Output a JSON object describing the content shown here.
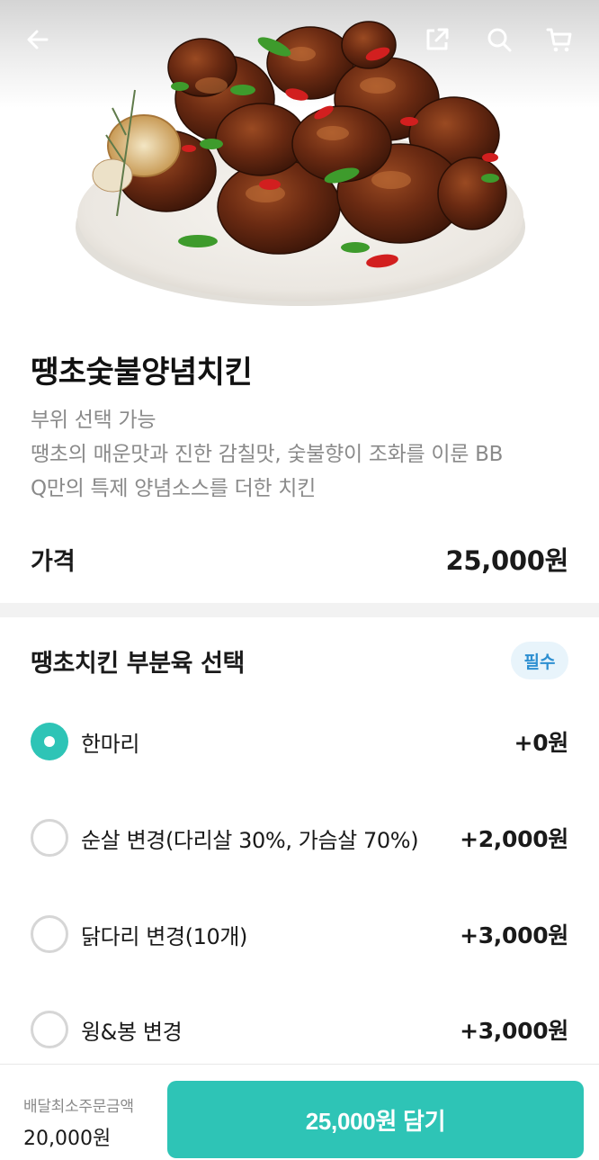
{
  "header": {
    "back_icon": "arrow-left-icon",
    "share_icon": "share-icon",
    "search_icon": "search-icon",
    "cart_icon": "cart-icon"
  },
  "product": {
    "name": "땡초숯불양념치킨",
    "description_lines": [
      "부위 선택 가능",
      "땡초의 매운맛과 진한 감칠맛, 숯불향이 조화를 이룬 BB",
      "Q만의 특제 양념소스를 더한 치킨"
    ],
    "price_label": "가격",
    "price_value": "25,000원"
  },
  "option_group": {
    "title": "땡초치킨 부분육 선택",
    "badge": "필수",
    "options": [
      {
        "label": "한마리",
        "price": "+0원",
        "selected": true
      },
      {
        "label": "순살 변경(다리살 30%, 가슴살 70%)",
        "price": "+2,000원",
        "selected": false
      },
      {
        "label": "닭다리 변경(10개)",
        "price": "+3,000원",
        "selected": false
      },
      {
        "label": "윙&봉 변경",
        "price": "+3,000원",
        "selected": false
      }
    ]
  },
  "footer": {
    "min_order_label": "배달최소주문금액",
    "min_order_value": "20,000원",
    "cart_button_label": "25,000원 담기"
  },
  "colors": {
    "accent": "#2ec4b6",
    "badge_bg": "#e8f4fb",
    "badge_text": "#2d8fd1"
  }
}
